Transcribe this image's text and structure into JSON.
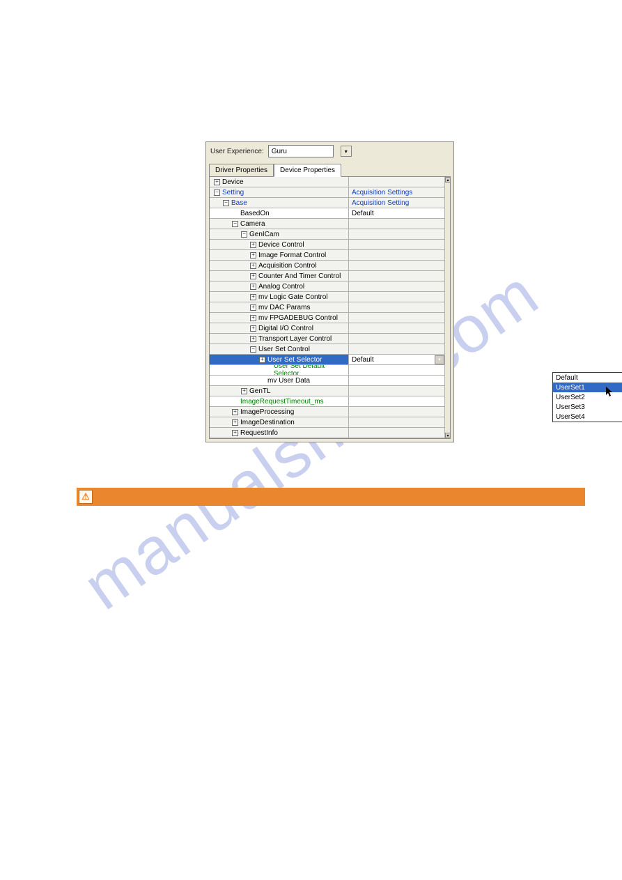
{
  "watermark": "manualshive.com",
  "ux": {
    "label": "User Experience:",
    "value": "Guru"
  },
  "tabs": {
    "driver": "Driver Properties",
    "device": "Device Properties"
  },
  "tree": [
    {
      "indent": 0,
      "exp": "+",
      "label": "Device",
      "value": "",
      "bg": "grey"
    },
    {
      "indent": 0,
      "exp": "-",
      "label": "Setting",
      "value": "Acquisition Settings",
      "bg": "grey",
      "labelClass": "link-like",
      "valueClass": "link-like"
    },
    {
      "indent": 1,
      "exp": "-",
      "label": "Base",
      "value": "Acquisition Setting",
      "bg": "grey",
      "labelClass": "link-like",
      "valueClass": "link-like"
    },
    {
      "indent": 2,
      "exp": "",
      "label": "BasedOn",
      "value": "Default",
      "bg": "white"
    },
    {
      "indent": 2,
      "exp": "-",
      "label": "Camera",
      "value": "",
      "bg": "grey"
    },
    {
      "indent": 3,
      "exp": "-",
      "label": "GenICam",
      "value": "",
      "bg": "grey"
    },
    {
      "indent": 4,
      "exp": "+",
      "label": "Device Control",
      "value": "",
      "bg": "grey"
    },
    {
      "indent": 4,
      "exp": "+",
      "label": "Image Format Control",
      "value": "",
      "bg": "grey"
    },
    {
      "indent": 4,
      "exp": "+",
      "label": "Acquisition Control",
      "value": "",
      "bg": "grey"
    },
    {
      "indent": 4,
      "exp": "+",
      "label": "Counter And Timer Control",
      "value": "",
      "bg": "grey"
    },
    {
      "indent": 4,
      "exp": "+",
      "label": "Analog Control",
      "value": "",
      "bg": "grey"
    },
    {
      "indent": 4,
      "exp": "+",
      "label": "mv Logic Gate Control",
      "value": "",
      "bg": "grey"
    },
    {
      "indent": 4,
      "exp": "+",
      "label": "mv DAC Params",
      "value": "",
      "bg": "grey"
    },
    {
      "indent": 4,
      "exp": "+",
      "label": "mv FPGADEBUG Control",
      "value": "",
      "bg": "grey"
    },
    {
      "indent": 4,
      "exp": "+",
      "label": "Digital I/O Control",
      "value": "",
      "bg": "grey"
    },
    {
      "indent": 4,
      "exp": "+",
      "label": "Transport Layer Control",
      "value": "",
      "bg": "grey"
    },
    {
      "indent": 4,
      "exp": "-",
      "label": "User Set Control",
      "value": "",
      "bg": "grey"
    },
    {
      "indent": 5,
      "exp": "+",
      "label": "User Set Selector",
      "value": "Default",
      "bg": "selected",
      "hasDropdown": true
    },
    {
      "indent": 6,
      "exp": "",
      "label": "User Set Default Selector",
      "value": "",
      "bg": "white",
      "labelClass": "green-text"
    },
    {
      "indent": 5,
      "exp": "",
      "label": "mv User Data",
      "value": "",
      "bg": "white"
    },
    {
      "indent": 3,
      "exp": "+",
      "label": "GenTL",
      "value": "",
      "bg": "grey"
    },
    {
      "indent": 2,
      "exp": "",
      "label": "ImageRequestTimeout_ms",
      "value": "",
      "bg": "white",
      "labelClass": "green-text"
    },
    {
      "indent": 2,
      "exp": "+",
      "label": "ImageProcessing",
      "value": "",
      "bg": "grey"
    },
    {
      "indent": 2,
      "exp": "+",
      "label": "ImageDestination",
      "value": "",
      "bg": "grey"
    },
    {
      "indent": 2,
      "exp": "+",
      "label": "RequestInfo",
      "value": "",
      "bg": "grey"
    }
  ],
  "dropdown": {
    "items": [
      "Default",
      "UserSet1",
      "UserSet2",
      "UserSet3",
      "UserSet4"
    ],
    "highlighted": 1
  },
  "warning_icon": "⚠"
}
